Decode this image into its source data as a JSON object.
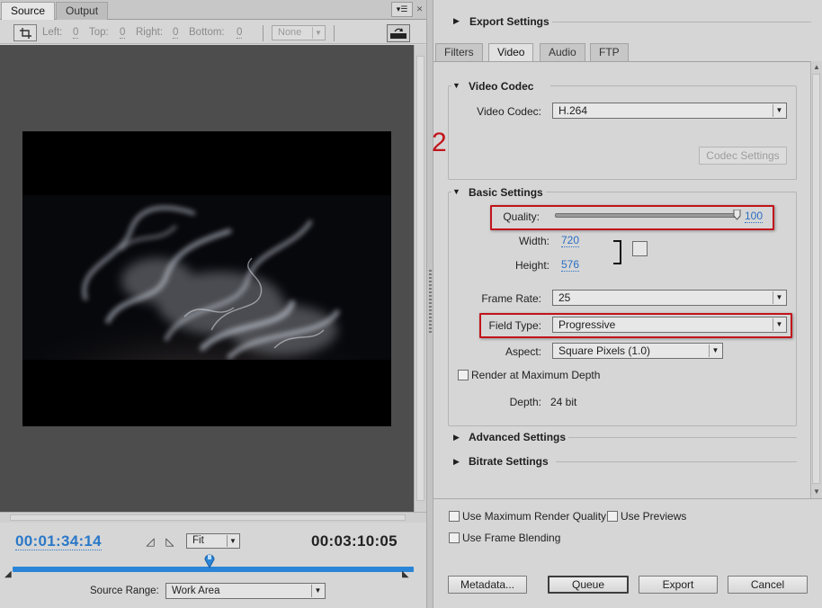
{
  "source_panel": {
    "tabs": [
      {
        "label": "Source",
        "active": true
      },
      {
        "label": "Output",
        "active": false
      }
    ],
    "crop": {
      "left_label": "Left:",
      "left_value": "0",
      "top_label": "Top:",
      "top_value": "0",
      "right_label": "Right:",
      "right_value": "0",
      "bottom_label": "Bottom:",
      "bottom_value": "0",
      "preset_value": "None"
    },
    "current_time": "00:01:34:14",
    "duration": "00:03:10:05",
    "zoom_value": "Fit",
    "playhead_position": 0.49,
    "source_range_label": "Source Range:",
    "source_range_value": "Work Area"
  },
  "annotation": {
    "step_number": "2",
    "color": "#c2141c"
  },
  "export_panel": {
    "export_settings_label": "Export Settings",
    "tabs": [
      {
        "label": "Filters",
        "active": false
      },
      {
        "label": "Video",
        "active": true
      },
      {
        "label": "Audio",
        "active": false
      },
      {
        "label": "FTP",
        "active": false
      }
    ],
    "video_codec": {
      "section_label": "Video Codec",
      "codec_label": "Video Codec:",
      "codec_value": "H.264",
      "codec_settings_button": "Codec Settings"
    },
    "basic_settings": {
      "section_label": "Basic Settings",
      "quality_label": "Quality:",
      "quality_value": "100",
      "quality_fraction": 1.0,
      "width_label": "Width:",
      "width_value": "720",
      "height_label": "Height:",
      "height_value": "576",
      "frame_rate_label": "Frame Rate:",
      "frame_rate_value": "25",
      "field_type_label": "Field Type:",
      "field_type_value": "Progressive",
      "aspect_label": "Aspect:",
      "aspect_value": "Square Pixels (1.0)",
      "render_max_depth_label": "Render at Maximum Depth",
      "depth_label": "Depth:",
      "depth_value": "24 bit"
    },
    "advanced_settings_label": "Advanced Settings",
    "bitrate_settings_label": "Bitrate Settings",
    "options": {
      "max_render_quality_label": "Use Maximum Render Quality",
      "use_previews_label": "Use Previews",
      "frame_blending_label": "Use Frame Blending"
    },
    "buttons": {
      "metadata": "Metadata...",
      "queue": "Queue",
      "export": "Export",
      "cancel": "Cancel"
    }
  }
}
